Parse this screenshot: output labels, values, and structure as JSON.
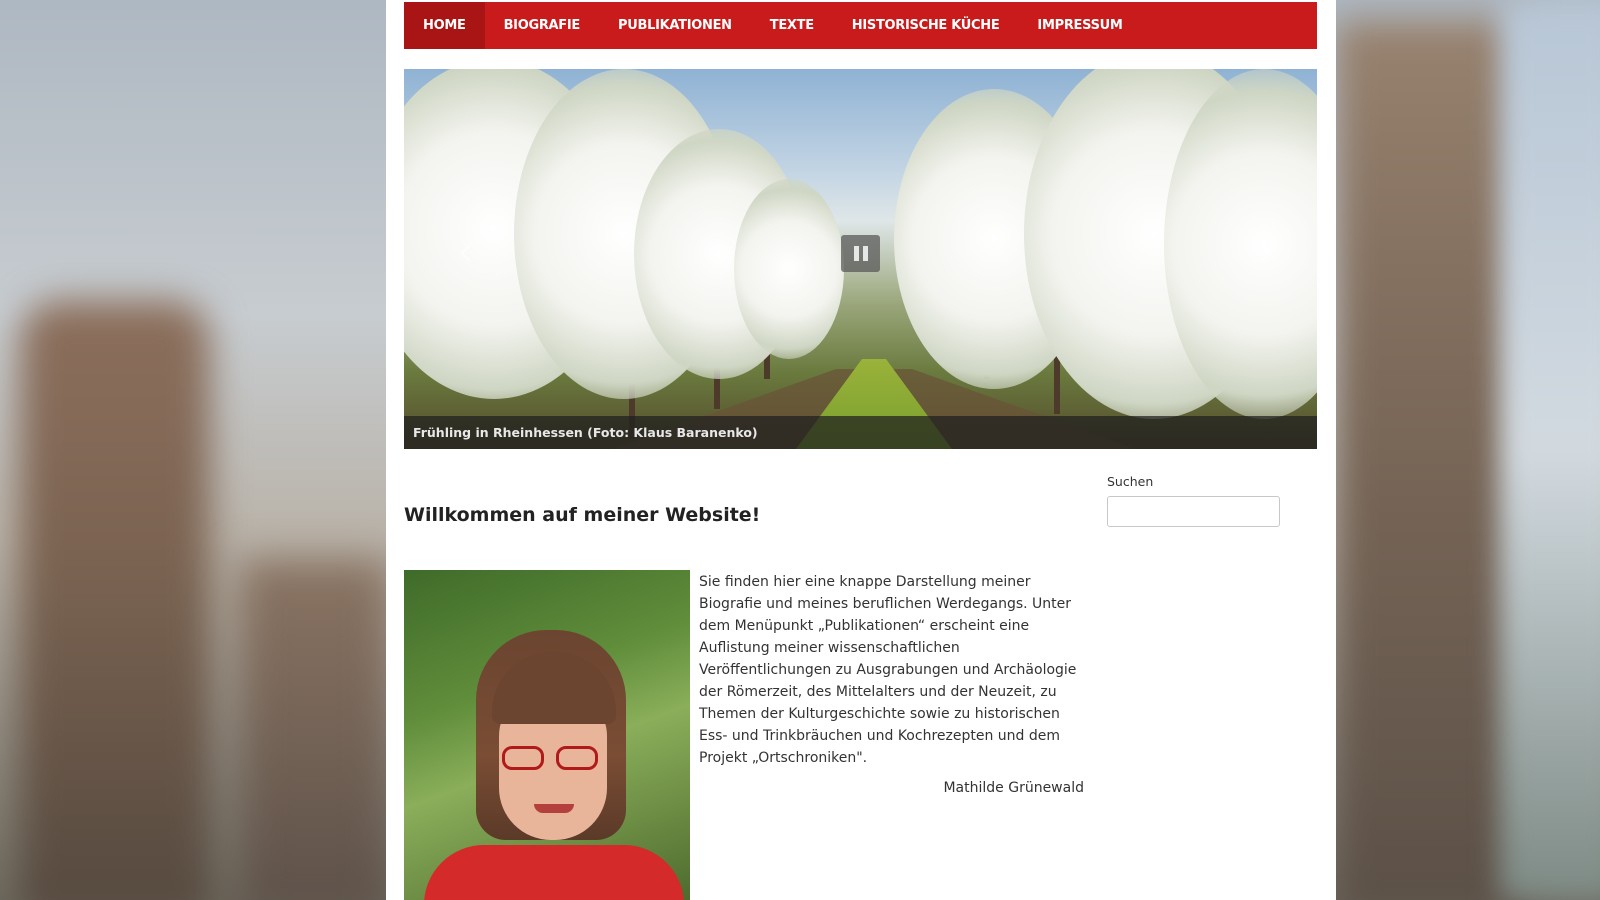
{
  "nav": {
    "items": [
      {
        "label": "HOME",
        "active": true
      },
      {
        "label": "BIOGRAFIE",
        "active": false
      },
      {
        "label": "PUBLIKATIONEN",
        "active": false
      },
      {
        "label": "TEXTE",
        "active": false
      },
      {
        "label": "HISTORISCHE KÜCHE",
        "active": false
      },
      {
        "label": "IMPRESSUM",
        "active": false
      }
    ]
  },
  "slider": {
    "caption": "Frühling in Rheinhessen (Foto: Klaus Baranenko)",
    "prev_icon": "chevron-left-icon",
    "next_icon": "chevron-right-icon",
    "pause_icon": "pause-icon"
  },
  "main": {
    "heading": "Willkommen auf meiner Website!",
    "intro": "Sie finden hier eine knappe Darstellung meiner Biografie und meines beruflichen Werdegangs. Unter dem Menüpunkt „Publikationen“ erscheint eine Auflistung meiner wissenschaftlichen Veröffentlichungen zu Ausgrabungen und Archäologie der Römerzeit, des Mittelalters und der Neuzeit, zu Themen der Kulturgeschichte sowie zu historischen Ess- und Trinkbräuchen und Kochrezepten und dem Projekt „Ortschroniken\".",
    "signature": "Mathilde Grünewald"
  },
  "sidebar": {
    "search_label": "Suchen",
    "search_value": ""
  },
  "colors": {
    "nav_bg": "#c91b1b",
    "nav_active_bg": "#a91414",
    "page_bg": "#ffffff"
  }
}
